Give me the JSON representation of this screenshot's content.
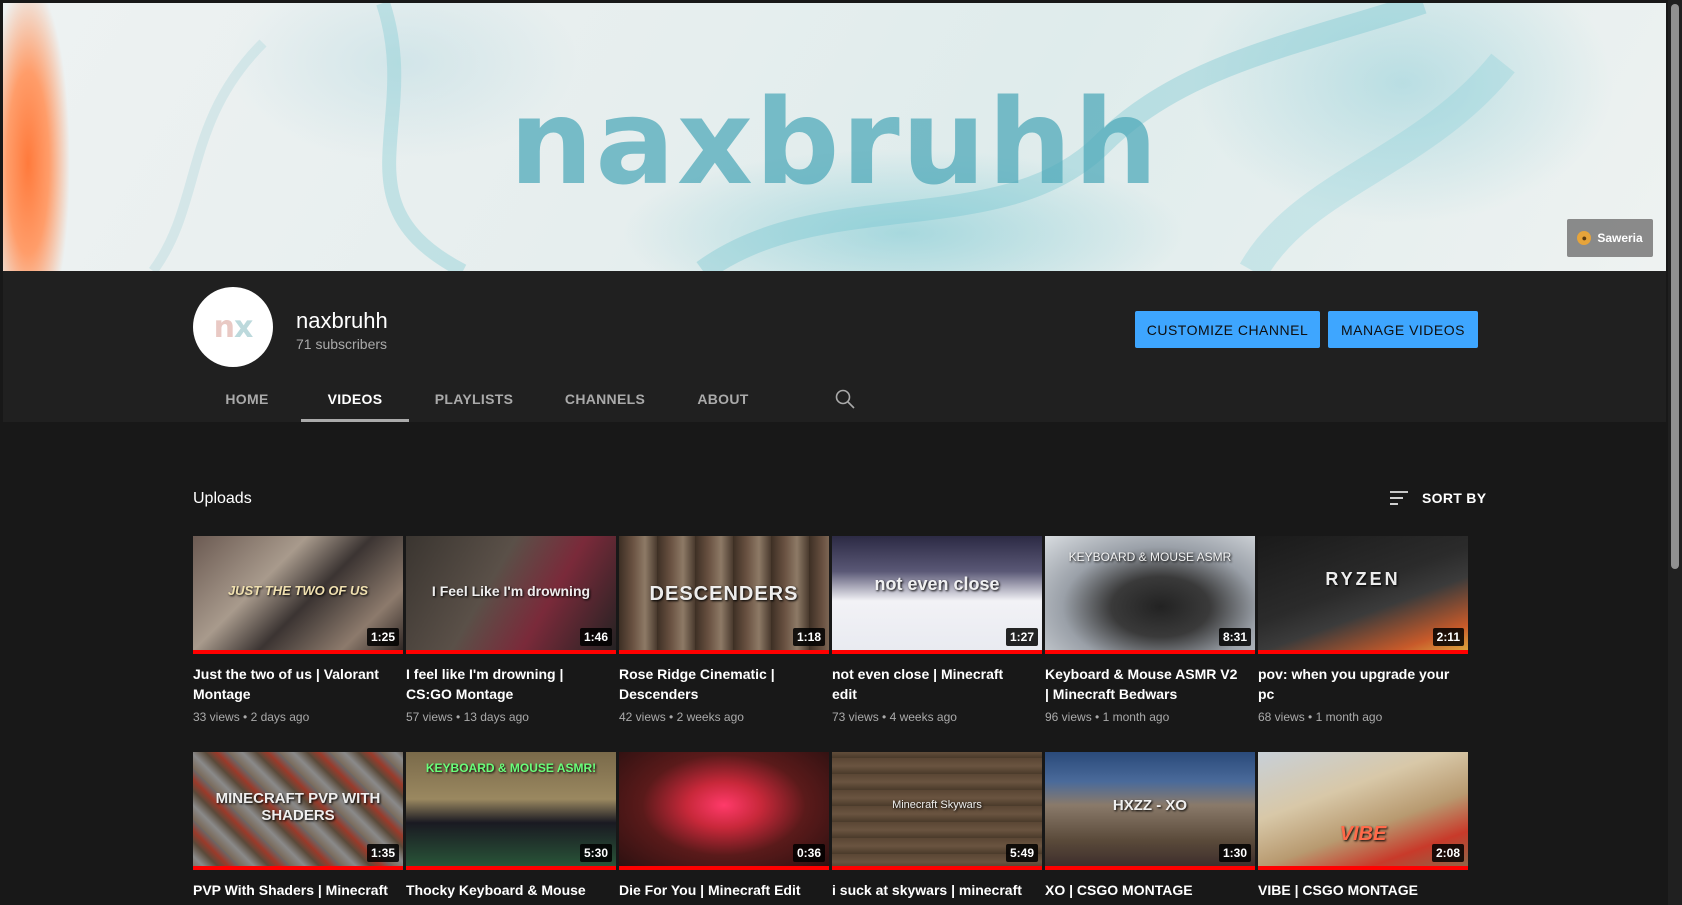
{
  "banner": {
    "title": "naxbruhh",
    "saweria_label": "Saweria",
    "saweria_icon": "paw-icon"
  },
  "channel": {
    "name": "naxbruhh",
    "subscribers": "71 subscribers",
    "avatar_text": "nx"
  },
  "buttons": {
    "customize": "CUSTOMIZE CHANNEL",
    "manage": "MANAGE VIDEOS"
  },
  "tabs": [
    {
      "label": "HOME"
    },
    {
      "label": "VIDEOS"
    },
    {
      "label": "PLAYLISTS"
    },
    {
      "label": "CHANNELS"
    },
    {
      "label": "ABOUT"
    }
  ],
  "active_tab": "VIDEOS",
  "uploads": {
    "title": "Uploads",
    "sort_label": "SORT BY"
  },
  "videos": [
    {
      "title": "Just the two of us | Valorant Montage",
      "views": "33 views",
      "age": "2 days ago",
      "duration": "1:25",
      "overlay": "JUST THE TWO OF US"
    },
    {
      "title": "I feel like I'm drowning | CS:GO Montage",
      "views": "57 views",
      "age": "13 days ago",
      "duration": "1:46",
      "overlay": "I Feel Like I'm drowning"
    },
    {
      "title": "Rose Ridge Cinematic | Descenders",
      "views": "42 views",
      "age": "2 weeks ago",
      "duration": "1:18",
      "overlay": "DESCENDERS"
    },
    {
      "title": "not even close | Minecraft edit",
      "views": "73 views",
      "age": "4 weeks ago",
      "duration": "1:27",
      "overlay": "not even close"
    },
    {
      "title": "Keyboard & Mouse ASMR V2 | Minecraft Bedwars",
      "views": "96 views",
      "age": "1 month ago",
      "duration": "8:31",
      "overlay": "KEYBOARD & MOUSE ASMR"
    },
    {
      "title": "pov: when you upgrade your pc",
      "views": "68 views",
      "age": "1 month ago",
      "duration": "2:11",
      "overlay": "RYZEN"
    },
    {
      "title": "PVP With Shaders | Minecraft Indonesia",
      "views": "",
      "age": "",
      "duration": "1:35",
      "overlay": "MINECRAFT PVP WITH SHADERS"
    },
    {
      "title": "Thocky Keyboard & Mouse ASMR! | Minecraft Bedwars",
      "views": "",
      "age": "",
      "duration": "5:30",
      "overlay": "KEYBOARD & MOUSE ASMR!"
    },
    {
      "title": "Die For You | Minecraft Edit (Inspired by Flinto)",
      "views": "",
      "age": "",
      "duration": "0:36",
      "overlay": ""
    },
    {
      "title": "i suck at skywars | minecraft (w/ keyboard & mouse asmr)",
      "views": "",
      "age": "",
      "duration": "5:49",
      "overlay": "Minecraft Skywars"
    },
    {
      "title": "XO | CSGO MONTAGE",
      "views": "",
      "age": "",
      "duration": "1:30",
      "overlay": "HXZZ - XO"
    },
    {
      "title": "VIBE | CSGO MONTAGE",
      "views": "",
      "age": "",
      "duration": "2:08",
      "overlay": "VIBE"
    }
  ],
  "colors": {
    "accent_blue": "#3ea6ff",
    "progress_red": "#ff0000",
    "background": "#181818",
    "header_bg": "#202020"
  }
}
